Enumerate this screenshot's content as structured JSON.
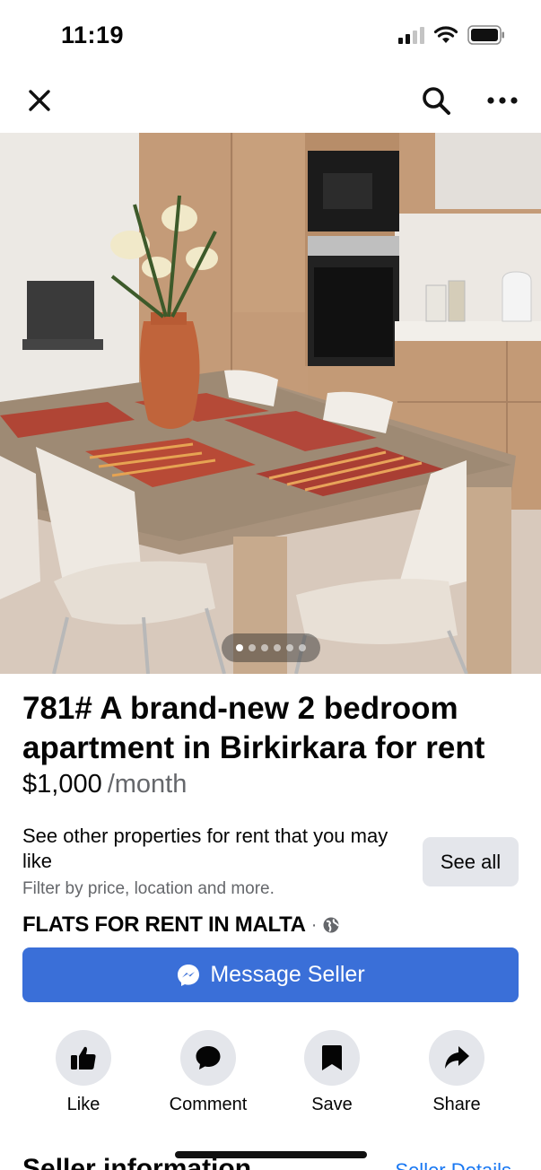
{
  "status_bar": {
    "time": "11:19"
  },
  "nav": {
    "close_icon": "close-icon",
    "search_icon": "search-icon",
    "more_icon": "more-icon"
  },
  "photo": {
    "total": 6,
    "active_index": 0
  },
  "listing": {
    "title": "781# A brand-new 2 bedroom apartment in Birkirkara for rent",
    "price": "$1,000",
    "period": "/month"
  },
  "suggestion": {
    "text": "See other properties for rent that you may like",
    "subtext": "Filter by price, location and more.",
    "button": "See all"
  },
  "group": {
    "name": "FLATS FOR RENT IN MALTA",
    "separator": "·",
    "privacy_icon": "globe-icon"
  },
  "message_button": {
    "label": "Message Seller",
    "icon": "messenger-icon"
  },
  "actions": [
    {
      "label": "Like",
      "icon": "thumbs-up-icon"
    },
    {
      "label": "Comment",
      "icon": "comment-icon"
    },
    {
      "label": "Save",
      "icon": "bookmark-icon"
    },
    {
      "label": "Share",
      "icon": "share-icon"
    }
  ],
  "seller": {
    "title": "Seller information",
    "link": "Seller Details"
  },
  "colors": {
    "accent": "#3a6fd8",
    "link": "#1877f2",
    "muted": "#65676b",
    "button_bg": "#e4e6eb"
  }
}
